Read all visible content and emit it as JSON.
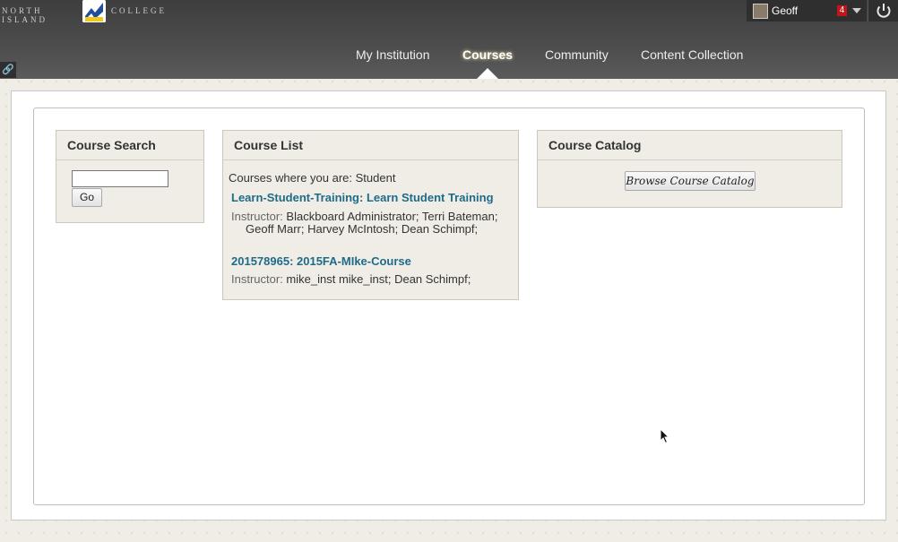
{
  "header": {
    "logo_left": "NORTH ISLAND",
    "logo_right": "COLLEGE",
    "user_name": "Geoff",
    "notification_count": "4",
    "nav": [
      {
        "label": "My Institution"
      },
      {
        "label": "Courses",
        "active": true
      },
      {
        "label": "Community"
      },
      {
        "label": "Content Collection"
      }
    ]
  },
  "course_search": {
    "title": "Course Search",
    "input_value": "",
    "go_label": "Go"
  },
  "course_list": {
    "title": "Course List",
    "role_text": "Courses where you are: Student",
    "courses": [
      {
        "name": "Learn-Student-Training: Learn Student Training",
        "instructor_label": "Instructor:",
        "instructors": "Blackboard Administrator;  Terri Bateman;  Geoff Marr;  Harvey McIntosh;  Dean Schimpf;"
      },
      {
        "name": "201578965: 2015FA-MIke-Course",
        "instructor_label": "Instructor:",
        "instructors": "mike_inst mike_inst;  Dean Schimpf;"
      }
    ]
  },
  "course_catalog": {
    "title": "Course Catalog",
    "button_label": "Browse Course Catalog"
  },
  "colors": {
    "accent_link": "#1f6b8a",
    "badge": "#c0161b",
    "header_bg": "#4a4a4a"
  },
  "icons": [
    "link-icon",
    "power-icon",
    "avatar",
    "chevron-down-icon",
    "cursor-icon"
  ]
}
